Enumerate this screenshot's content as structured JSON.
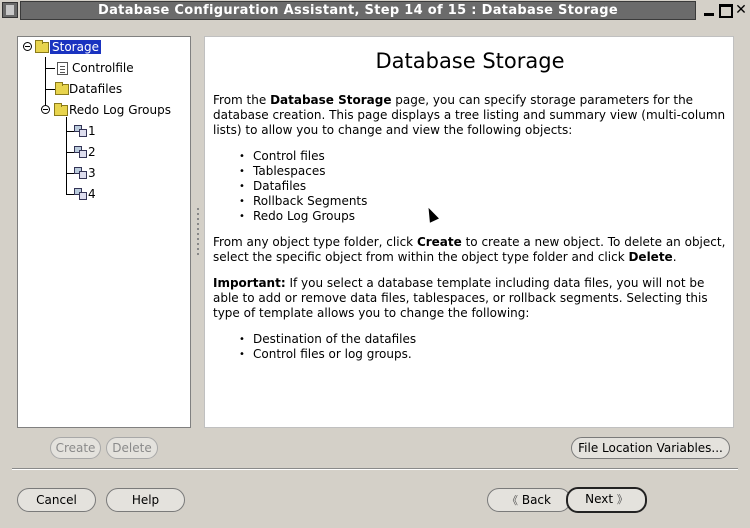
{
  "window": {
    "title": "Database Configuration Assistant, Step 14 of 15 : Database Storage",
    "controls": {
      "minimize": "minimize-icon",
      "maximize": "maximize-icon",
      "close": "✕"
    }
  },
  "tree": {
    "root_label": "Storage",
    "controlfile_label": "Controlfile",
    "datafiles_label": "Datafiles",
    "redo_label": "Redo Log Groups",
    "redo_groups": [
      "1",
      "2",
      "3",
      "4"
    ]
  },
  "content": {
    "heading": "Database Storage",
    "intro_pre": "From the ",
    "intro_bold": "Database Storage",
    "intro_post": " page, you can specify storage parameters for the database creation. This page displays a tree listing and summary view (multi-column lists) to allow you to change and view the following objects:",
    "objects": [
      "Control files",
      "Tablespaces",
      "Datafiles",
      "Rollback Segments",
      "Redo Log Groups"
    ],
    "create_pre": "From any object type folder, click ",
    "create_bold": "Create",
    "create_mid": " to create a new object. To delete an object, select the specific object from within the object type folder and click ",
    "delete_bold": "Delete",
    "create_end": ".",
    "important_bold": "Important:",
    "important_text": " If you select a database template including data files, you will not be able to add or remove data files, tablespaces, or rollback segments. Selecting this type of template allows you to change the following:",
    "changes": [
      "Destination of the datafiles",
      "Control files or log groups."
    ]
  },
  "buttons": {
    "create": "Create",
    "delete": "Delete",
    "file_location": "File Location Variables...",
    "cancel": "Cancel",
    "help": "Help",
    "back": "Back",
    "next": "Next",
    "back_arrow": "《",
    "next_arrow": "》"
  },
  "colors": {
    "title_bg": "#6b6b6b",
    "selection": "#1a33c0",
    "dialog_bg": "#d4d0c8"
  }
}
